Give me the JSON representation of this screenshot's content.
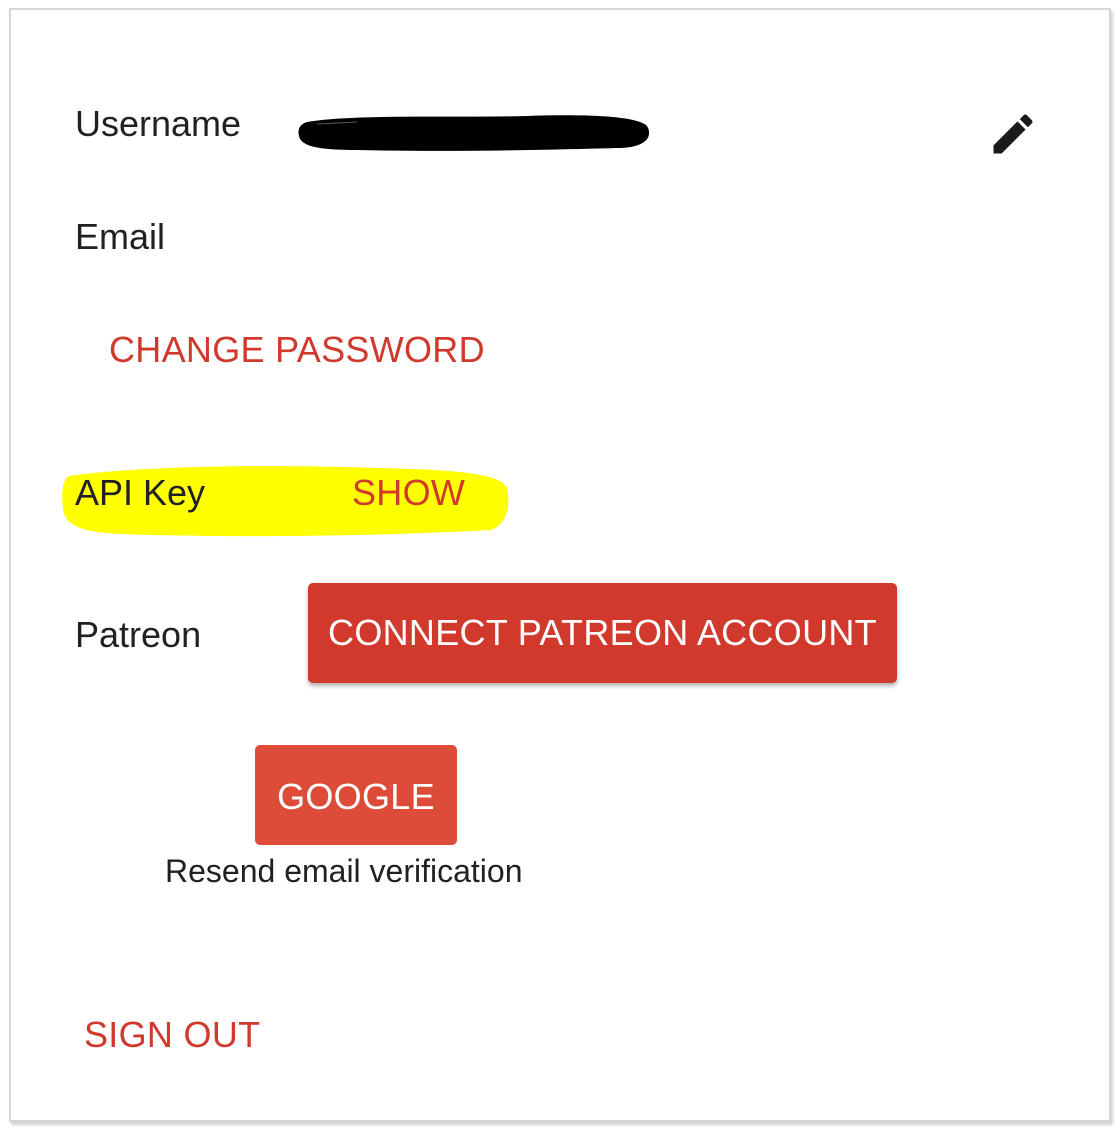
{
  "profile": {
    "username_label": "Username",
    "email_label": "Email",
    "change_password_label": "CHANGE PASSWORD",
    "api_key_label": "API Key",
    "api_key_show_label": "SHOW",
    "patreon_label": "Patreon",
    "connect_patreon_label": "CONNECT PATREON ACCOUNT",
    "google_label": "GOOGLE",
    "resend_verification_label": "Resend email verification",
    "sign_out_label": "SIGN OUT"
  },
  "colors": {
    "accent": "#d0392c",
    "patreon_button": "#d1392c",
    "google_button": "#dd4b39",
    "highlight": "#ffff00"
  },
  "icons": {
    "edit": "pencil-icon"
  }
}
